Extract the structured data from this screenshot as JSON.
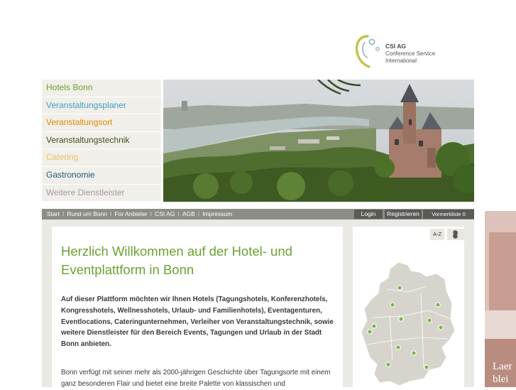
{
  "logo": {
    "brand": "CSI AG",
    "line1": "Conference Service",
    "line2": "International"
  },
  "leftnav": {
    "items": [
      {
        "label": "Hotels Bonn",
        "color": "#6aa232"
      },
      {
        "label": "Veranstaltungsplaner",
        "color": "#3e9fc2"
      },
      {
        "label": "Veranstaltungsort",
        "color": "#e58a00"
      },
      {
        "label": "Veranstaltungstechnik",
        "color": "#454f1e"
      },
      {
        "label": "Catering",
        "color": "#f3bd63"
      },
      {
        "label": "Gastronomie",
        "color": "#1e5b77"
      },
      {
        "label": "Weitere Dienstleister",
        "color": "#a59aa4"
      }
    ]
  },
  "topnav": {
    "links": [
      "Start",
      "Rund um Bonn",
      "Für Anbieter",
      "CSI AG",
      "AGB",
      "Impressum"
    ],
    "login": "Login",
    "register": "Registrieren",
    "merkliste": "Vormerkliste 0"
  },
  "content": {
    "title": "Herzlich Willkommen auf der Hotel- und Eventplattform in Bonn",
    "intro": "Auf dieser Plattform möchten wir Ihnen Hotels (Tagungshotels, Konferenzhotels, Kongresshotels, Wellnesshotels, Urlaub- und Familienhotels), Eventagenturen, Eventlocations, Cateringunternehmen, Verleiher von Veranstaltungstechnik, sowie weitere Dienstleister für den Bereich Events, Tagungen und Urlaub in der Stadt Bonn anbieten.",
    "body": "Bonn verfügt mit seiner mehr als 2000-jährigen Geschichte über Tagungsorte mit einem ganz besonderen Flair und bietet eine breite Palette von klassischen und"
  },
  "mappanel": {
    "az_label": "A-Z",
    "map_icon": "germany-icon"
  },
  "ad": {
    "line1": "Laer",
    "line2": "blei"
  },
  "colors": {
    "accent": "#6aa232",
    "bar": "#8c8d88",
    "panel_bg": "#eae9e3"
  }
}
